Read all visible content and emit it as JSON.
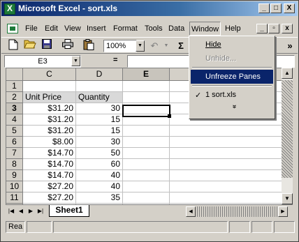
{
  "window": {
    "title": "Microsoft Excel - sort.xls",
    "caption_buttons": [
      "_",
      "□",
      "X"
    ],
    "doc_buttons": [
      "_",
      "▫",
      "x"
    ]
  },
  "menubar": {
    "items": [
      "File",
      "Edit",
      "View",
      "Insert",
      "Format",
      "Tools",
      "Data",
      "Window",
      "Help"
    ],
    "active": "Window"
  },
  "toolbar": {
    "icons": [
      "new-icon",
      "open-icon",
      "save-icon",
      "print-icon",
      "paste-icon"
    ],
    "zoom": "100%",
    "undo_glyph": "↶",
    "sum_glyph": "Σ",
    "more_glyph": "»"
  },
  "formulabar": {
    "namebox": "E3",
    "equals": "=",
    "formula": ""
  },
  "grid": {
    "columns": [
      "C",
      "D",
      "E"
    ],
    "active_column": "E",
    "active_row": "3",
    "rows": [
      {
        "num": "1",
        "price": "",
        "qty": "",
        "e": ""
      },
      {
        "num": "2",
        "price": "Unit Price",
        "qty": "Quantity",
        "e": ""
      },
      {
        "num": "3",
        "price": "$31.20",
        "qty": "30",
        "e": ""
      },
      {
        "num": "4",
        "price": "$31.20",
        "qty": "15",
        "e": ""
      },
      {
        "num": "5",
        "price": "$31.20",
        "qty": "15",
        "e": ""
      },
      {
        "num": "6",
        "price": "$8.00",
        "qty": "30",
        "e": ""
      },
      {
        "num": "7",
        "price": "$14.70",
        "qty": "50",
        "e": ""
      },
      {
        "num": "8",
        "price": "$14.70",
        "qty": "60",
        "e": ""
      },
      {
        "num": "9",
        "price": "$14.70",
        "qty": "40",
        "e": ""
      },
      {
        "num": "10",
        "price": "$27.20",
        "qty": "40",
        "e": ""
      },
      {
        "num": "11",
        "price": "$27.20",
        "qty": "35",
        "e": ""
      },
      {
        "num": "12",
        "price": "$27.20",
        "qty": "30",
        "e": ""
      }
    ]
  },
  "sheet_tabs": {
    "nav": [
      "|◀",
      "◀",
      "▶",
      "▶|"
    ],
    "active": "Sheet1"
  },
  "statusbar": {
    "text": "Rea"
  },
  "window_menu": {
    "items": [
      {
        "label": "Hide",
        "state": "enabled"
      },
      {
        "label": "Unhide...",
        "state": "disabled"
      },
      {
        "label": "Unfreeze Panes",
        "state": "selected"
      },
      {
        "label": "1 sort.xls",
        "state": "checked"
      }
    ],
    "check_glyph": "✓",
    "expand_glyph": "»"
  }
}
